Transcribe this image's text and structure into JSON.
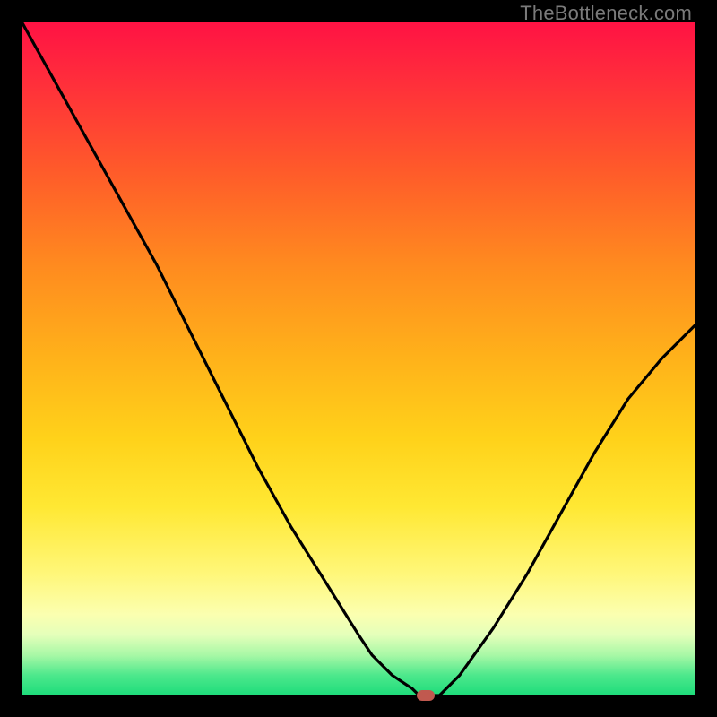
{
  "watermark": "TheBottleneck.com",
  "colors": {
    "frame": "#000000",
    "curve": "#000000",
    "marker": "#c0594f"
  },
  "chart_data": {
    "type": "line",
    "title": "",
    "xlabel": "",
    "ylabel": "",
    "xlim": [
      0,
      100
    ],
    "ylim": [
      0,
      100
    ],
    "x": [
      0,
      5,
      10,
      15,
      20,
      22,
      25,
      30,
      35,
      40,
      45,
      50,
      52,
      55,
      58,
      59,
      60,
      62,
      65,
      70,
      75,
      80,
      85,
      90,
      95,
      100
    ],
    "values": [
      100,
      91,
      82,
      73,
      64,
      60,
      54,
      44,
      34,
      25,
      17,
      9,
      6,
      3,
      1,
      0,
      0,
      0,
      3,
      10,
      18,
      27,
      36,
      44,
      50,
      55
    ],
    "marker": {
      "x": 60,
      "y": 0
    },
    "note": "Values are estimated from the figure; y=0 at the bottom green band, y=100 at the top."
  }
}
